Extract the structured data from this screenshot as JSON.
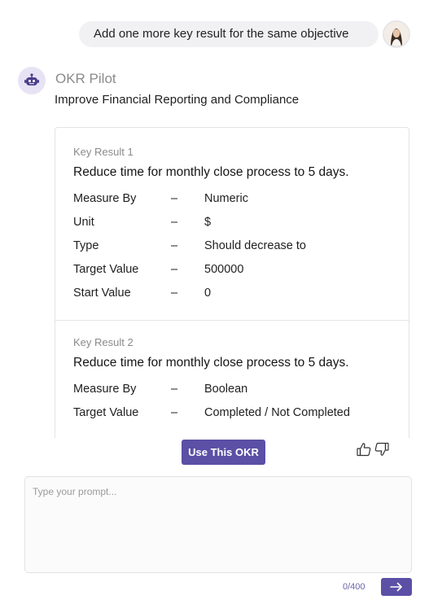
{
  "user_message": "Add one more key result for the same objective",
  "bot": {
    "name": "OKR Pilot",
    "objective": "Improve Financial Reporting and Compliance"
  },
  "key_results": [
    {
      "label": "Key Result 1",
      "title": "Reduce time for monthly close process to 5 days.",
      "rows": [
        {
          "key": "Measure By",
          "value": "Numeric"
        },
        {
          "key": "Unit",
          "value": "$"
        },
        {
          "key": "Type",
          "value": "Should decrease to"
        },
        {
          "key": "Target Value",
          "value": "500000"
        },
        {
          "key": "Start Value",
          "value": "0"
        }
      ]
    },
    {
      "label": "Key Result 2",
      "title": "Reduce time for monthly close process to 5 days.",
      "rows": [
        {
          "key": "Measure By",
          "value": "Boolean"
        },
        {
          "key": "Target Value",
          "value": "Completed / Not Completed"
        }
      ]
    }
  ],
  "separator": "–",
  "actions": {
    "use_okr_label": "Use This OKR",
    "thumbs_up_icon": "thumbs-up-icon",
    "thumbs_down_icon": "thumbs-down-icon"
  },
  "composer": {
    "placeholder": "Type your prompt...",
    "counter": "0/400",
    "send_icon": "arrow-right-icon"
  },
  "colors": {
    "accent": "#5b4fa6",
    "bubble": "#f1f1f3",
    "bot_avatar_bg": "#e7e3f4"
  }
}
